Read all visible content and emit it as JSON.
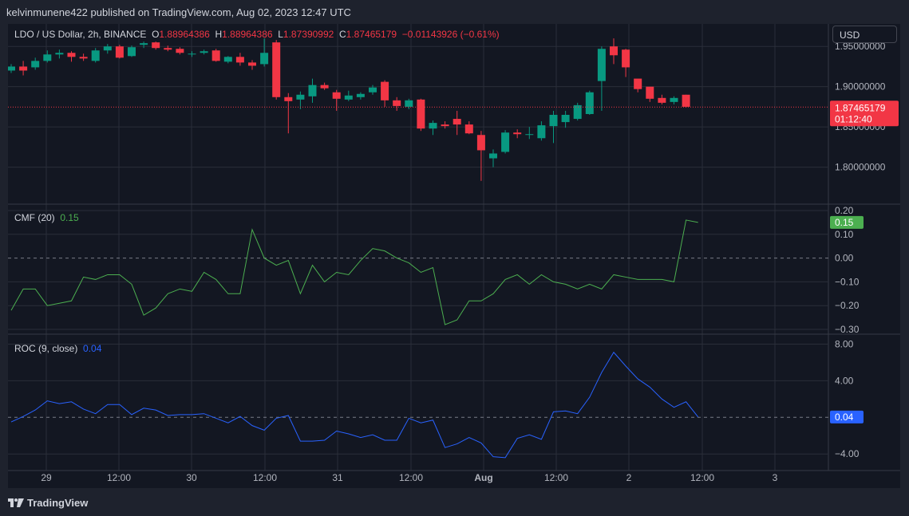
{
  "header": {
    "published": "kelvinmunene422 published on TradingView.com, Aug 02, 2023 12:47 UTC"
  },
  "legend": {
    "symbol": "LDO / US Dollar, 2h, BINANCE",
    "o_label": "O",
    "o_value": "1.88964386",
    "h_label": "H",
    "h_value": "1.88964386",
    "l_label": "L",
    "l_value": "1.87390992",
    "c_label": "C",
    "c_value": "1.87465179",
    "change": "−0.01143926 (−0.61%)"
  },
  "currency_button": "USD",
  "price_badge": {
    "price": "1.87465179",
    "countdown": "01:12:40"
  },
  "cmf": {
    "label": "CMF (20)",
    "value": "0.15"
  },
  "roc": {
    "label": "ROC (9, close)",
    "value": "0.04"
  },
  "colors": {
    "up": "#089981",
    "down": "#f23645",
    "cmf": "#4caf50",
    "roc": "#2962ff",
    "bg": "#131722"
  },
  "footer": {
    "brand": "TradingView"
  },
  "chart_data": [
    {
      "type": "candlestick",
      "title": "LDO / US Dollar, 2h, BINANCE",
      "ylim": [
        1.76,
        1.97
      ],
      "y_ticks": [
        "1.95000000",
        "1.90000000",
        "1.85000000",
        "1.80000000"
      ],
      "x_ticks": [
        "29",
        "12:00",
        "30",
        "12:00",
        "31",
        "12:00",
        "Aug",
        "12:00",
        "2",
        "12:00",
        "3"
      ],
      "last_price": 1.87465179,
      "candles": [
        [
          1.92,
          1.928,
          1.917,
          1.925
        ],
        [
          1.925,
          1.932,
          1.914,
          1.92
        ],
        [
          1.924,
          1.936,
          1.921,
          1.932
        ],
        [
          1.932,
          1.945,
          1.93,
          1.94
        ],
        [
          1.94,
          1.946,
          1.935,
          1.942
        ],
        [
          1.942,
          1.944,
          1.931,
          1.937
        ],
        [
          1.937,
          1.941,
          1.932,
          1.935
        ],
        [
          1.932,
          1.948,
          1.93,
          1.945
        ],
        [
          1.945,
          1.953,
          1.941,
          1.95
        ],
        [
          1.95,
          1.952,
          1.935,
          1.936
        ],
        [
          1.938,
          1.951,
          1.937,
          1.949
        ],
        [
          1.952,
          1.956,
          1.948,
          1.954
        ],
        [
          1.955,
          1.956,
          1.946,
          1.948
        ],
        [
          1.948,
          1.951,
          1.944,
          1.946
        ],
        [
          1.947,
          1.949,
          1.94,
          1.942
        ],
        [
          1.94,
          1.944,
          1.937,
          1.941
        ],
        [
          1.942,
          1.946,
          1.94,
          1.944
        ],
        [
          1.945,
          1.947,
          1.931,
          1.932
        ],
        [
          1.931,
          1.938,
          1.929,
          1.937
        ],
        [
          1.937,
          1.942,
          1.926,
          1.93
        ],
        [
          1.93,
          1.933,
          1.921,
          1.926
        ],
        [
          1.928,
          1.96,
          1.925,
          1.942
        ],
        [
          1.955,
          1.958,
          1.884,
          1.887
        ],
        [
          1.887,
          1.892,
          1.842,
          1.882
        ],
        [
          1.884,
          1.894,
          1.872,
          1.89
        ],
        [
          1.888,
          1.91,
          1.88,
          1.902
        ],
        [
          1.902,
          1.905,
          1.896,
          1.898
        ],
        [
          1.893,
          1.896,
          1.87,
          1.885
        ],
        [
          1.884,
          1.895,
          1.882,
          1.889
        ],
        [
          1.887,
          1.893,
          1.884,
          1.891
        ],
        [
          1.893,
          1.902,
          1.89,
          1.899
        ],
        [
          1.906,
          1.908,
          1.875,
          1.883
        ],
        [
          1.883,
          1.887,
          1.87,
          1.876
        ],
        [
          1.875,
          1.885,
          1.872,
          1.883
        ],
        [
          1.884,
          1.885,
          1.845,
          1.848
        ],
        [
          1.848,
          1.858,
          1.84,
          1.855
        ],
        [
          1.853,
          1.857,
          1.848,
          1.851
        ],
        [
          1.86,
          1.87,
          1.84,
          1.853
        ],
        [
          1.853,
          1.857,
          1.841,
          1.842
        ],
        [
          1.84,
          1.845,
          1.783,
          1.821
        ],
        [
          1.811,
          1.822,
          1.8,
          1.817
        ],
        [
          1.819,
          1.846,
          1.817,
          1.843
        ],
        [
          1.843,
          1.847,
          1.836,
          1.841
        ],
        [
          1.84,
          1.85,
          1.835,
          1.841
        ],
        [
          1.836,
          1.857,
          1.833,
          1.852
        ],
        [
          1.851,
          1.87,
          1.83,
          1.865
        ],
        [
          1.856,
          1.87,
          1.849,
          1.865
        ],
        [
          1.86,
          1.88,
          1.858,
          1.877
        ],
        [
          1.866,
          1.895,
          1.865,
          1.893
        ],
        [
          1.907,
          1.95,
          1.87,
          1.947
        ],
        [
          1.95,
          1.96,
          1.928,
          1.939
        ],
        [
          1.946,
          1.947,
          1.912,
          1.924
        ],
        [
          1.91,
          1.908,
          1.893,
          1.897
        ],
        [
          1.9,
          1.895,
          1.881,
          1.885
        ],
        [
          1.886,
          1.89,
          1.878,
          1.88
        ],
        [
          1.881,
          1.888,
          1.878,
          1.886
        ],
        [
          1.89,
          1.89,
          1.874,
          1.875
        ]
      ]
    },
    {
      "type": "line",
      "name": "CMF (20)",
      "ylim": [
        -0.31,
        0.21
      ],
      "y_ticks": [
        "0.20",
        "0.10",
        "0.00",
        "−0.10",
        "−0.20",
        "−0.30"
      ],
      "values": [
        -0.22,
        -0.13,
        -0.13,
        -0.2,
        -0.19,
        -0.18,
        -0.08,
        -0.09,
        -0.07,
        -0.07,
        -0.11,
        -0.24,
        -0.21,
        -0.15,
        -0.13,
        -0.14,
        -0.06,
        -0.09,
        -0.15,
        -0.15,
        0.12,
        0.0,
        -0.03,
        -0.01,
        -0.15,
        -0.03,
        -0.1,
        -0.06,
        -0.07,
        -0.01,
        0.04,
        0.03,
        0.0,
        -0.02,
        -0.06,
        -0.04,
        -0.28,
        -0.26,
        -0.18,
        -0.18,
        -0.15,
        -0.09,
        -0.07,
        -0.11,
        -0.07,
        -0.1,
        -0.11,
        -0.13,
        -0.11,
        -0.13,
        -0.07,
        -0.08,
        -0.09,
        -0.09,
        -0.09,
        -0.1,
        0.16,
        0.15
      ]
    },
    {
      "type": "line",
      "name": "ROC (9, close)",
      "ylim": [
        -5.2,
        8.3
      ],
      "y_ticks": [
        "8.00",
        "4.00",
        "0.00",
        "−4.00"
      ],
      "values": [
        -0.5,
        0.1,
        0.8,
        1.8,
        1.5,
        1.7,
        0.9,
        0.4,
        1.4,
        1.4,
        0.3,
        1.0,
        0.8,
        0.2,
        0.3,
        0.3,
        0.4,
        -0.1,
        -0.6,
        0.1,
        -0.9,
        -1.4,
        -0.1,
        0.2,
        -2.6,
        -2.6,
        -2.5,
        -1.5,
        -1.8,
        -2.2,
        -1.9,
        -2.5,
        -2.5,
        -0.1,
        -0.6,
        -0.3,
        -3.3,
        -2.9,
        -2.2,
        -2.8,
        -4.3,
        -4.4,
        -2.3,
        -1.9,
        -2.4,
        0.6,
        0.7,
        0.4,
        2.2,
        4.9,
        7.1,
        5.6,
        4.2,
        3.3,
        2.0,
        1.1,
        1.7,
        0.04
      ]
    }
  ]
}
